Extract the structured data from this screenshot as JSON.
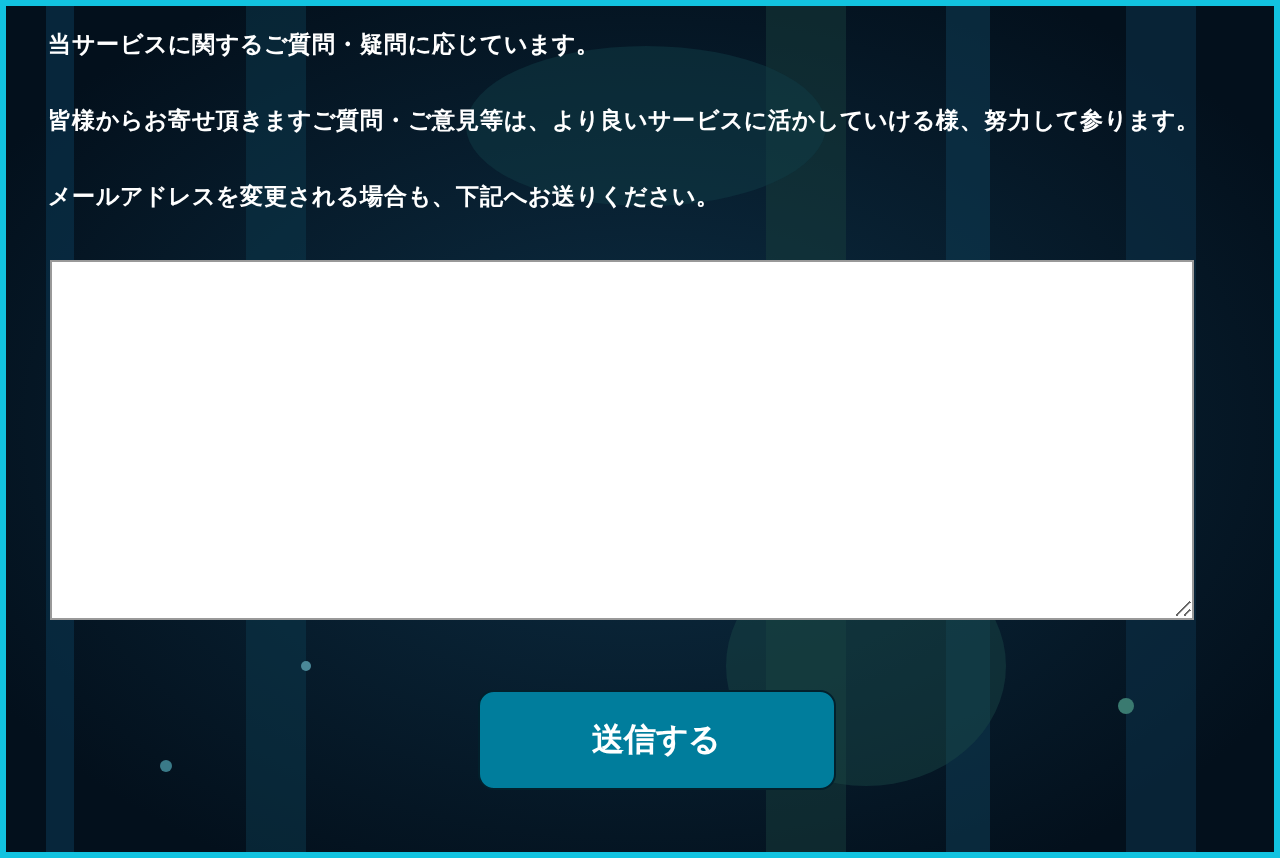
{
  "paragraphs": [
    "当サービスに関するご質問・疑問に応じています。",
    "皆様からお寄せ頂きますご質問・ご意見等は、より良いサービスに活かしていける様、努力して参ります。",
    "メールアドレスを変更される場合も、下記へお送りください。"
  ],
  "submit_button": {
    "label": "送信する"
  }
}
